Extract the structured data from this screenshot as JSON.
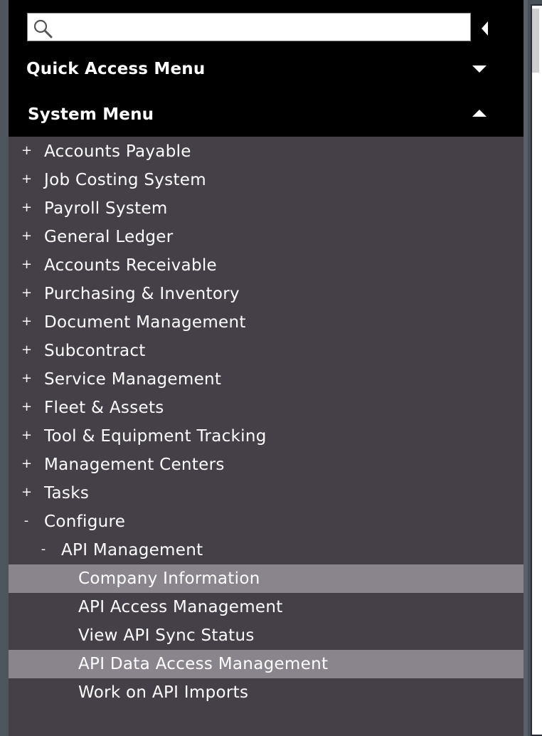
{
  "search": {
    "value": "",
    "placeholder": ""
  },
  "quick_access": {
    "title": "Quick Access Menu",
    "arrow": "chevron-down-icon"
  },
  "system_menu": {
    "title": "System Menu",
    "arrow": "chevron-up-icon",
    "items": [
      {
        "sign": "+",
        "label": "Accounts Payable",
        "level": 0,
        "highlight": false
      },
      {
        "sign": "+",
        "label": "Job Costing System",
        "level": 0,
        "highlight": false
      },
      {
        "sign": "+",
        "label": "Payroll System",
        "level": 0,
        "highlight": false
      },
      {
        "sign": "+",
        "label": "General Ledger",
        "level": 0,
        "highlight": false
      },
      {
        "sign": "+",
        "label": "Accounts Receivable",
        "level": 0,
        "highlight": false
      },
      {
        "sign": "+",
        "label": "Purchasing & Inventory",
        "level": 0,
        "highlight": false
      },
      {
        "sign": "+",
        "label": "Document Management",
        "level": 0,
        "highlight": false
      },
      {
        "sign": "+",
        "label": "Subcontract",
        "level": 0,
        "highlight": false
      },
      {
        "sign": "+",
        "label": "Service Management",
        "level": 0,
        "highlight": false
      },
      {
        "sign": "+",
        "label": "Fleet & Assets",
        "level": 0,
        "highlight": false
      },
      {
        "sign": "+",
        "label": "Tool & Equipment Tracking",
        "level": 0,
        "highlight": false
      },
      {
        "sign": "+",
        "label": "Management Centers",
        "level": 0,
        "highlight": false
      },
      {
        "sign": "+",
        "label": "Tasks",
        "level": 0,
        "highlight": false
      },
      {
        "sign": "-",
        "label": "Configure",
        "level": 0,
        "highlight": false
      },
      {
        "sign": "-",
        "label": "API Management",
        "level": 1,
        "highlight": false
      },
      {
        "sign": "",
        "label": "Company Information",
        "level": 2,
        "highlight": true
      },
      {
        "sign": "",
        "label": "API Access Management",
        "level": 2,
        "highlight": false
      },
      {
        "sign": "",
        "label": "View API Sync Status",
        "level": 2,
        "highlight": false
      },
      {
        "sign": "",
        "label": "API Data Access Management",
        "level": 2,
        "highlight": true
      },
      {
        "sign": "",
        "label": "Work on API Imports",
        "level": 2,
        "highlight": false
      }
    ]
  }
}
